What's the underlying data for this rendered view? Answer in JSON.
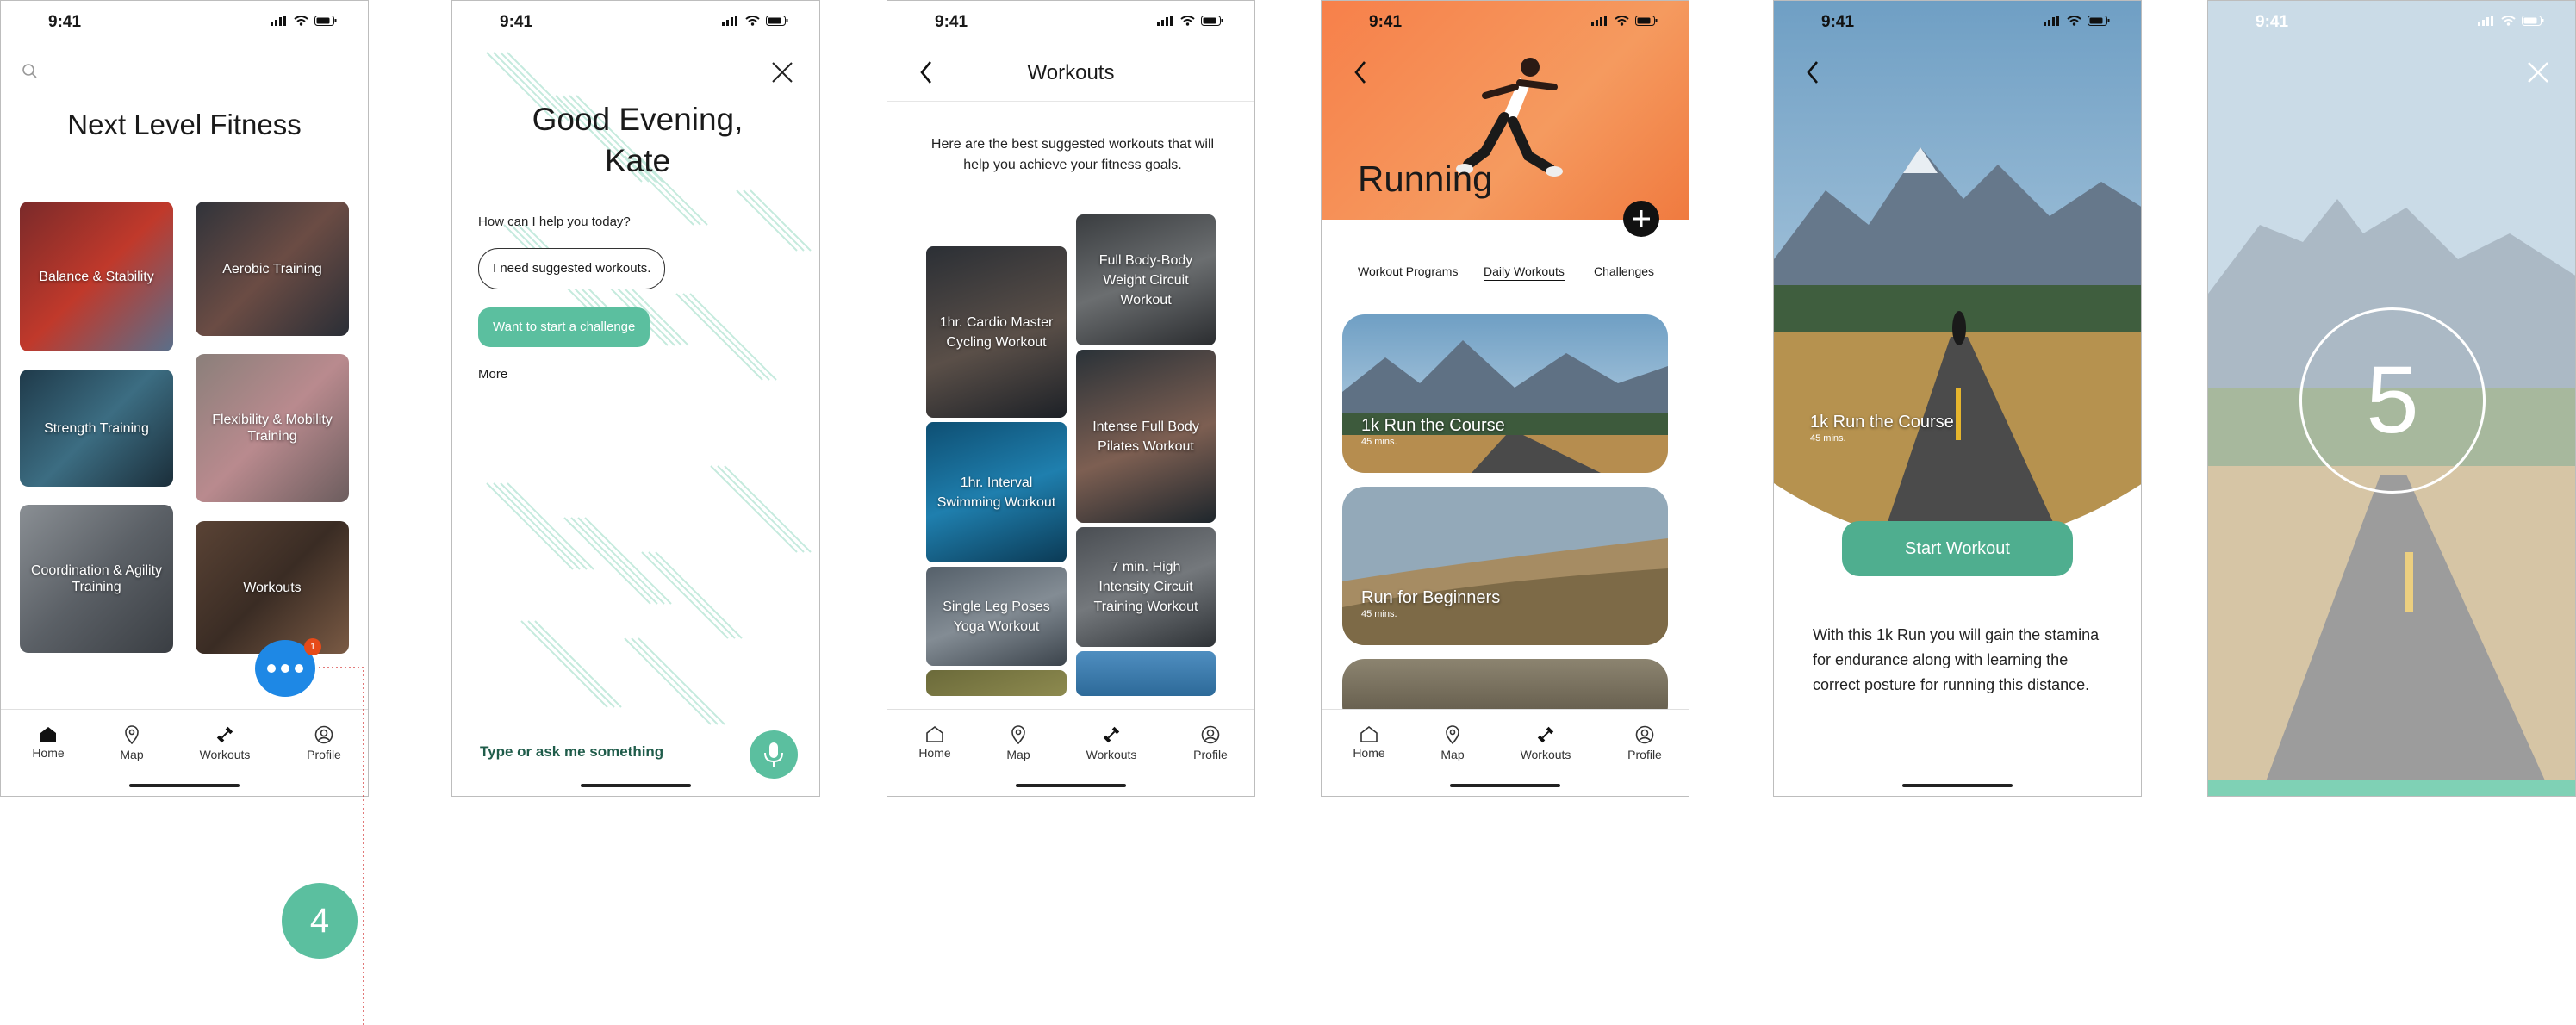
{
  "status": {
    "time": "9:41"
  },
  "tabs": [
    "Home",
    "Map",
    "Workouts",
    "Profile"
  ],
  "screen1": {
    "title": "Next Level Fitness",
    "tiles": [
      "Balance & Stability",
      "Aerobic Training",
      "Strength Training",
      "Flexibility & Mobility Training",
      "Coordination & Agility Training",
      "Workouts"
    ],
    "chat_badge": "1",
    "step_number": "4"
  },
  "screen2": {
    "greeting": "Good Evening, Kate",
    "prompt": "How can I help you today?",
    "option_1": "I need suggested workouts.",
    "option_2": "Want to start a challenge",
    "more": "More",
    "input_placeholder": "Type or ask me something"
  },
  "screen3": {
    "title": "Workouts",
    "intro": "Here are the best suggested workouts that will help you achieve your fitness goals.",
    "left_tiles": [
      "1hr. Cardio Master Cycling Workout",
      "1hr. Interval Swimming Workout",
      "Single Leg Poses Yoga Workout",
      ""
    ],
    "right_tiles": [
      "Full Body-Body Weight Circuit Workout",
      "Intense Full Body Pilates Workout",
      "7 min. High Intensity Circuit Training Workout",
      ""
    ]
  },
  "screen4": {
    "title": "Running",
    "tabs": [
      "Workout Programs",
      "Daily Workouts",
      "Challenges"
    ],
    "cards": [
      {
        "title": "1k Run the Course",
        "sub": "45 mins."
      },
      {
        "title": "Run for Beginners",
        "sub": "45 mins."
      },
      {
        "title": "",
        "sub": ""
      }
    ]
  },
  "screen5": {
    "title": "1k Run the Course",
    "sub": "45 mins.",
    "cta": "Start Workout",
    "description": "With this 1k Run you will gain the stamina for endurance along with learning the correct posture for running this distance."
  },
  "screen6": {
    "countdown": "5"
  },
  "colors": {
    "accent": "#5bbf9f",
    "orange": "#f58a4e",
    "link_red": "#d32f2f",
    "chat_blue": "#1e88e5"
  }
}
